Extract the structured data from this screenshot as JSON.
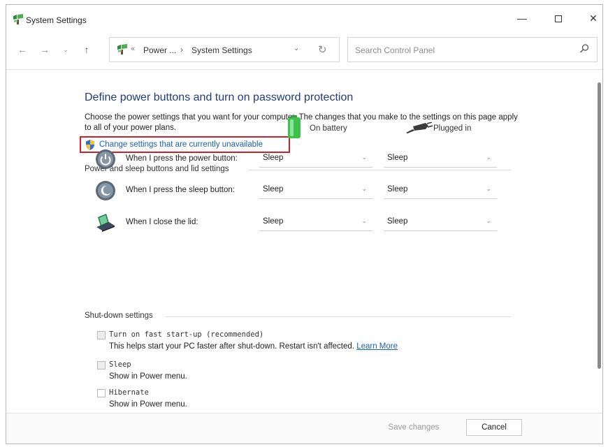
{
  "window": {
    "title": "System Settings",
    "minimize_glyph": "—",
    "close_glyph": "✕"
  },
  "nav": {
    "back_glyph": "←",
    "forward_glyph": "→",
    "recent_glyph": "⌄",
    "up_glyph": "↑",
    "address_sep": "«",
    "crumbs": [
      "Power ...",
      "System Settings"
    ],
    "crumb_arrow": "›",
    "dropdown_glyph": "⌄",
    "refresh_glyph": "↻",
    "search_placeholder": "Search Control Panel"
  },
  "main": {
    "title": "Define power buttons and turn on password protection",
    "description": "Choose the power settings that you want for your computer. The changes that you make to the settings on this page apply to all of your power plans.",
    "change_link": "Change settings that are currently unavailable",
    "power_section_label": "Power and sleep buttons and lid settings",
    "col_battery": "On battery",
    "col_plugged": "Plugged in",
    "rows": [
      {
        "label": "When I press the power button:",
        "battery": "Sleep",
        "plugged": "Sleep"
      },
      {
        "label": "When I press the sleep button:",
        "battery": "Sleep",
        "plugged": "Sleep"
      },
      {
        "label": "When I close the lid:",
        "battery": "Sleep",
        "plugged": "Sleep"
      }
    ],
    "chevron_glyph": "⌄",
    "shutdown_section_label": "Shut-down settings",
    "shutdown": {
      "fast_startup_label": "Turn on fast start-up (recommended)",
      "fast_startup_desc": "This helps start your PC faster after shut-down. Restart isn't affected.",
      "learn_more": "Learn More",
      "sleep_label": "Sleep",
      "sleep_desc": "Show in Power menu.",
      "hibernate_label": "Hibernate",
      "hibernate_desc": "Show in Power menu."
    }
  },
  "footer": {
    "save_label": "Save changes",
    "cancel_label": "Cancel"
  },
  "colors": {
    "title_blue": "#1f3d7a",
    "link_blue": "#1a5fb4",
    "highlight_red": "#d0202a"
  }
}
